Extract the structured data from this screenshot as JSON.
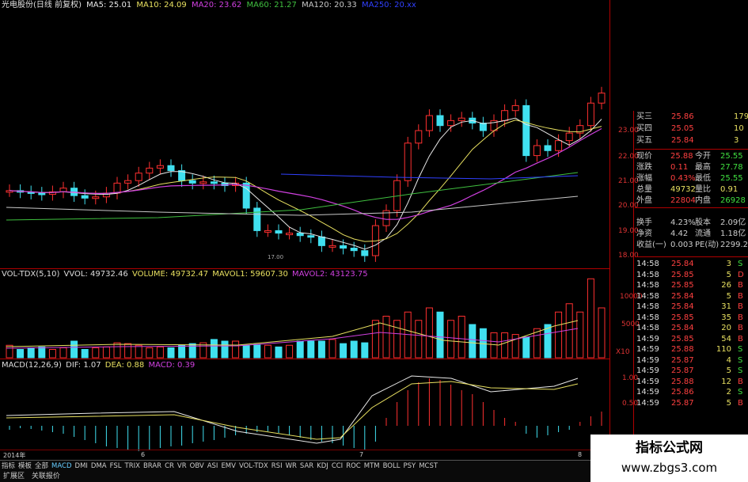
{
  "header": {
    "stock": "光电股份(日线 前复权)",
    "ma5": "MA5: 25.01",
    "ma10": "MA10: 24.09",
    "ma20": "MA20: 23.62",
    "ma60": "MA60: 21.27",
    "ma120": "MA120: 20.33",
    "ma250": "MA250: 20.xx"
  },
  "colors": {
    "up": "#ff3030",
    "down": "#40e0f0",
    "ma5": "#e8e8e8",
    "ma10": "#e8e060",
    "ma20": "#d040e0",
    "ma60": "#40c040",
    "ma120": "#c8c8c8",
    "ma250": "#3040ff"
  },
  "price_axis": [
    "23.00",
    "22.00",
    "21.00",
    "20.00",
    "19.00",
    "18.00"
  ],
  "low_marker": "17.00",
  "volume_header": {
    "name": "VOL-TDX(5,10)",
    "vvol": "VVOL: 49732.46",
    "volume": "VOLUME: 49732.47",
    "mavol1": "MAVOL1: 59607.30",
    "mavol2": "MAVOL2: 43123.75"
  },
  "volume_axis": [
    "10000",
    "5000",
    "X10"
  ],
  "macd_header": {
    "name": "MACD(12,26,9)",
    "dif": "DIF: 1.07",
    "dea": "DEA: 0.88",
    "macd": "MACD: 0.39"
  },
  "macd_axis": [
    "1.00",
    "0.50"
  ],
  "date_axis": {
    "year": "2014年",
    "m1": "6",
    "m2": "7",
    "m3": "8"
  },
  "tabs": [
    "指标",
    "模板",
    "全部",
    "MACD",
    "DMI",
    "DMA",
    "FSL",
    "TRIX",
    "BRAR",
    "CR",
    "VR",
    "OBV",
    "ASI",
    "EMV",
    "VOL-TDX",
    "RSI",
    "WR",
    "SAR",
    "KDJ",
    "CCI",
    "ROC",
    "MTM",
    "BOLL",
    "PSY",
    "MCST"
  ],
  "bottom_tabs": [
    "扩展区",
    "关联报价"
  ],
  "order_book": [
    {
      "label": "买三",
      "price": "25.86",
      "vol": "179"
    },
    {
      "label": "买四",
      "price": "25.05",
      "vol": "10"
    },
    {
      "label": "买五",
      "price": "25.84",
      "vol": "3"
    }
  ],
  "quote": [
    {
      "l1": "现价",
      "v1": "25.88",
      "l2": "今开",
      "v2": "25.55"
    },
    {
      "l1": "涨跌",
      "v1": "0.11",
      "l2": "最高",
      "v2": "27.78"
    },
    {
      "l1": "涨幅",
      "v1": "0.43%",
      "l2": "最低",
      "v2": "25.55"
    },
    {
      "l1": "总量",
      "v1": "49732",
      "l2": "量比",
      "v2": "0.91"
    },
    {
      "l1": "外盘",
      "v1": "22804",
      "l2": "内盘",
      "v2": "26928"
    },
    {
      "l1": "换手",
      "v1": "4.23%",
      "l2": "股本",
      "v2": "2.09亿"
    },
    {
      "l1": "净资",
      "v1": "4.42",
      "l2": "流通",
      "v2": "1.18亿"
    },
    {
      "l1": "收益(一)",
      "v1": "0.003",
      "l2": "PE(动)",
      "v2": "2299.2"
    }
  ],
  "ticks": [
    {
      "time": "14:58",
      "price": "25.84",
      "vol": "3",
      "side": "S"
    },
    {
      "time": "14:58",
      "price": "25.85",
      "vol": "5",
      "side": "D"
    },
    {
      "time": "14:58",
      "price": "25.85",
      "vol": "26",
      "side": "B"
    },
    {
      "time": "14:58",
      "price": "25.84",
      "vol": "5",
      "side": "B"
    },
    {
      "time": "14:58",
      "price": "25.84",
      "vol": "31",
      "side": "B"
    },
    {
      "time": "14:58",
      "price": "25.85",
      "vol": "35",
      "side": "B"
    },
    {
      "time": "14:58",
      "price": "25.84",
      "vol": "20",
      "side": "B"
    },
    {
      "time": "14:59",
      "price": "25.85",
      "vol": "54",
      "side": "B"
    },
    {
      "time": "14:59",
      "price": "25.88",
      "vol": "110",
      "side": "S"
    },
    {
      "time": "14:59",
      "price": "25.87",
      "vol": "4",
      "side": "S"
    },
    {
      "time": "14:59",
      "price": "25.87",
      "vol": "5",
      "side": "S"
    },
    {
      "time": "14:59",
      "price": "25.88",
      "vol": "12",
      "side": "B"
    },
    {
      "time": "14:59",
      "price": "25.86",
      "vol": "2",
      "side": "S"
    },
    {
      "time": "14:59",
      "price": "25.87",
      "vol": "5",
      "side": "B"
    }
  ],
  "watermark": {
    "title": "指标公式网",
    "url": "www.zbgs3.com"
  }
}
